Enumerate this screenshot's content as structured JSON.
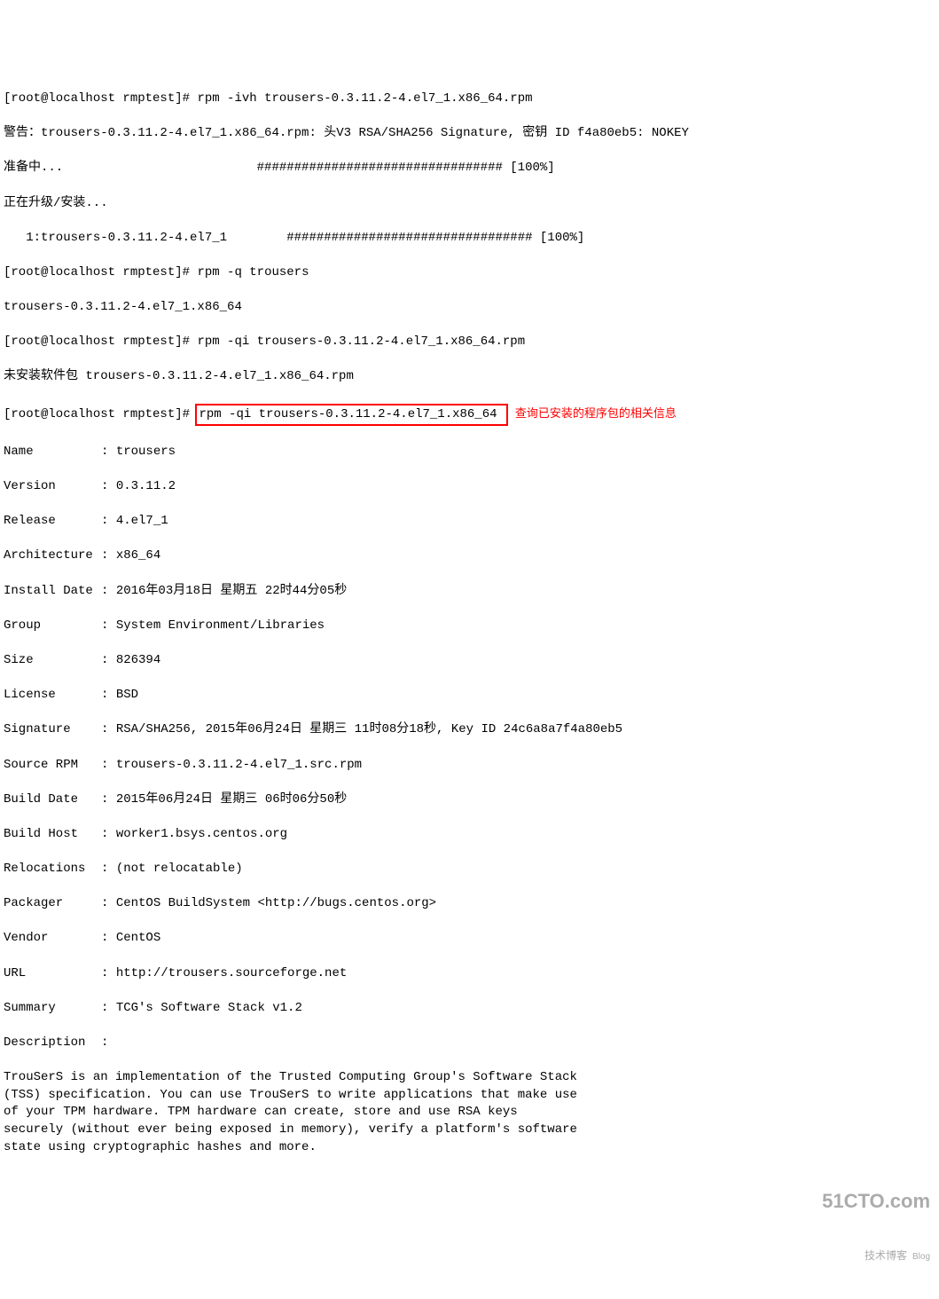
{
  "prompt": "[root@localhost rmptest]#",
  "commands": {
    "install": "rpm -ivh trousers-0.3.11.2-4.el7_1.x86_64.rpm",
    "query": "rpm -q trousers",
    "queryinfo_rpm": "rpm -qi trousers-0.3.11.2-4.el7_1.x86_64.rpm",
    "queryinfo": "rpm -qi trousers-0.3.11.2-4.el7_1.x86_64"
  },
  "output": {
    "warning": "警告：trousers-0.3.11.2-4.el7_1.x86_64.rpm: 头V3 RSA/SHA256 Signature, 密钥 ID f4a80eb5: NOKEY",
    "preparing": "准备中...                          ################################# [100%]",
    "upgrading": "正在升级/安装...",
    "installing": "   1:trousers-0.3.11.2-4.el7_1        ################################# [100%]",
    "query_result": "trousers-0.3.11.2-4.el7_1.x86_64",
    "not_installed": "未安装软件包 trousers-0.3.11.2-4.el7_1.x86_64.rpm"
  },
  "annotation": "查询已安装的程序包的相关信息",
  "info": {
    "name_label": "Name",
    "name_value": "trousers",
    "version_label": "Version",
    "version_value": "0.3.11.2",
    "release_label": "Release",
    "release_value": "4.el7_1",
    "architecture_label": "Architecture",
    "architecture_value": "x86_64",
    "install_date_label": "Install Date",
    "install_date_value": "2016年03月18日 星期五 22时44分05秒",
    "group_label": "Group",
    "group_value": "System Environment/Libraries",
    "size_label": "Size",
    "size_value": "826394",
    "license_label": "License",
    "license_value": "BSD",
    "signature_label": "Signature",
    "signature_value": "RSA/SHA256, 2015年06月24日 星期三 11时08分18秒, Key ID 24c6a8a7f4a80eb5",
    "source_rpm_label": "Source RPM",
    "source_rpm_value": "trousers-0.3.11.2-4.el7_1.src.rpm",
    "build_date_label": "Build Date",
    "build_date_value": "2015年06月24日 星期三 06时06分50秒",
    "build_host_label": "Build Host",
    "build_host_value": "worker1.bsys.centos.org",
    "relocations_label": "Relocations",
    "relocations_value": "(not relocatable)",
    "packager_label": "Packager",
    "packager_value": "CentOS BuildSystem <http://bugs.centos.org>",
    "vendor_label": "Vendor",
    "vendor_value": "CentOS",
    "url_label": "URL",
    "url_value": "http://trousers.sourceforge.net",
    "summary_label": "Summary",
    "summary_value": "TCG's Software Stack v1.2",
    "description_label": "Description",
    "description_value": "TrouSerS is an implementation of the Trusted Computing Group's Software Stack\n(TSS) specification. You can use TrouSerS to write applications that make use\nof your TPM hardware. TPM hardware can create, store and use RSA keys\nsecurely (without ever being exposed in memory), verify a platform's software\nstate using cryptographic hashes and more."
  },
  "watermark": {
    "main": "51CTO.com",
    "sub": "技术博客",
    "blog": "Blog"
  }
}
